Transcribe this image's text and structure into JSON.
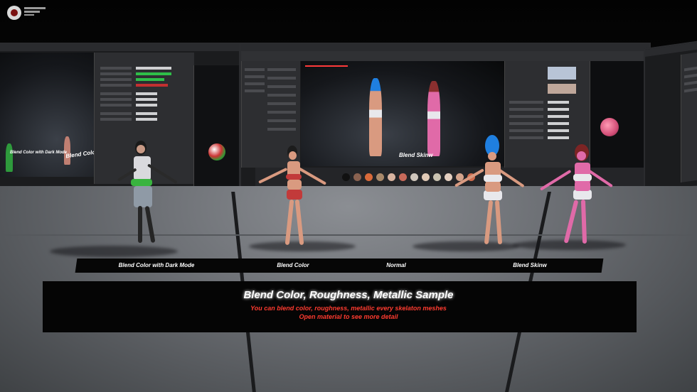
{
  "scene": {
    "labels": [
      "Blend Color with Dark Mode",
      "Blend Color",
      "Normal",
      "Blend Skinw"
    ],
    "title": "Blend Color, Roughness, Metallic Sample",
    "subtitle_line1": "You can blend color, roughness, metallic every skelaton meshes",
    "subtitle_line2": "Open material to see more detail",
    "monitor_left_caption_1": "Blend Color with Dark Mode",
    "monitor_left_caption_2": "Blend Color, Roughn",
    "monitor_center_caption": "Blend Skinw",
    "colors": {
      "subtitle_red": "#ff3b2f",
      "skin": "#d99a80",
      "pink_skin": "#e06aa8",
      "blue_hair": "#1f7fe0",
      "outfit_white": "#e8e8ec",
      "outfit_red": "#c23a3a",
      "green_sash": "#39b43f"
    }
  }
}
